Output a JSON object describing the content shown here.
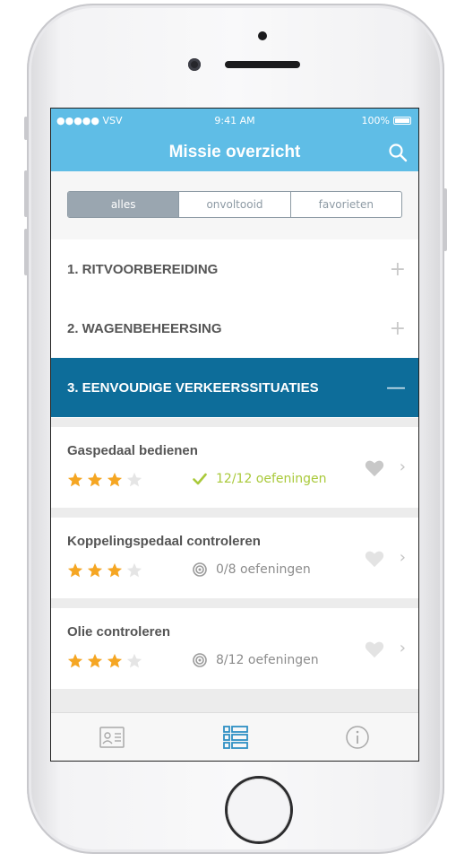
{
  "status_bar": {
    "carrier": "●●●●● VSV",
    "time": "9:41 AM",
    "battery": "100%"
  },
  "nav": {
    "title": "Missie overzicht"
  },
  "segments": [
    {
      "label": "alles",
      "active": true
    },
    {
      "label": "onvoltooid",
      "active": false
    },
    {
      "label": "favorieten",
      "active": false
    }
  ],
  "sections": [
    {
      "label": "1. RITVOORBEREIDING",
      "toggle": "+"
    },
    {
      "label": "2. WAGENBEHEERSING",
      "toggle": "+"
    },
    {
      "label": "3. EENVOUDIGE VERKEERSSITUATIES",
      "toggle": "—"
    }
  ],
  "items": [
    {
      "name": "Gaspedaal bedienen",
      "rating": 3,
      "max_rating": 4,
      "progress": "12/12 oefeningen",
      "status": "completed"
    },
    {
      "name": "Koppelingspedaal controleren",
      "rating": 3,
      "max_rating": 4,
      "progress": "0/8 oefeningen",
      "status": "in-progress"
    },
    {
      "name": "Olie controleren",
      "rating": 3,
      "max_rating": 4,
      "progress": "8/12 oefeningen",
      "status": "in-progress"
    }
  ],
  "colors": {
    "accent": "#5fbde6",
    "section_open": "#0d6d9a",
    "star": "#f5a623",
    "done": "#a9c93a"
  },
  "tabs": [
    {
      "icon": "id-card-icon",
      "active": false
    },
    {
      "icon": "list-icon",
      "active": true
    },
    {
      "icon": "info-icon",
      "active": false
    }
  ]
}
